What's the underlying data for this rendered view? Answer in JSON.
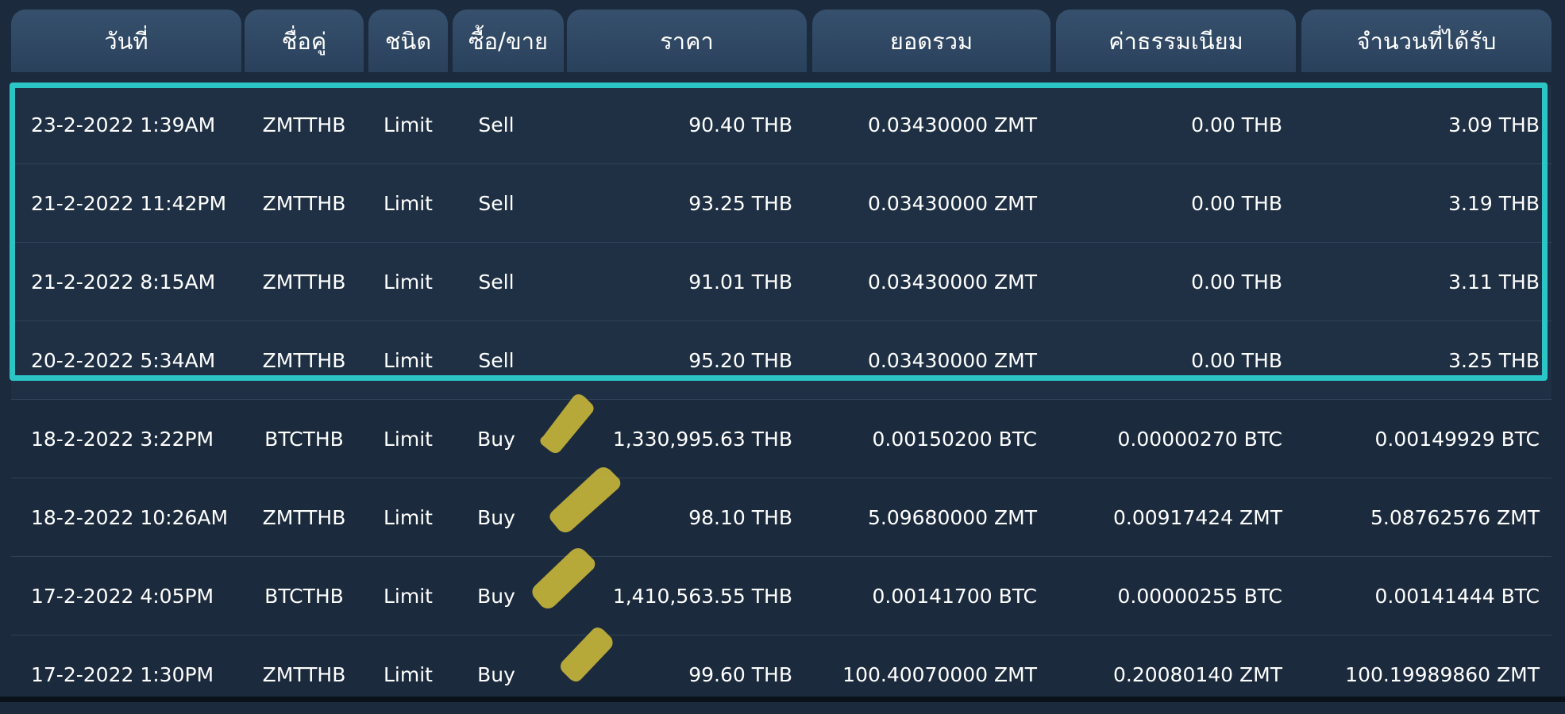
{
  "header": {
    "columns": [
      "วันที่",
      "ชื่อคู่",
      "ชนิด",
      "ซื้อ/ขาย",
      "ราคา",
      "ยอดรวม",
      "ค่าธรรมเนียม",
      "จำนวนที่ได้รับ"
    ]
  },
  "rows": [
    {
      "date": "23-2-2022 1:39AM",
      "pair": "ZMTTHB",
      "type": "Limit",
      "side": "Sell",
      "price": "90.40 THB",
      "total": "0.03430000 ZMT",
      "fee": "0.00 THB",
      "received": "3.09 THB"
    },
    {
      "date": "21-2-2022 11:42PM",
      "pair": "ZMTTHB",
      "type": "Limit",
      "side": "Sell",
      "price": "93.25 THB",
      "total": "0.03430000 ZMT",
      "fee": "0.00 THB",
      "received": "3.19 THB"
    },
    {
      "date": "21-2-2022 8:15AM",
      "pair": "ZMTTHB",
      "type": "Limit",
      "side": "Sell",
      "price": "91.01 THB",
      "total": "0.03430000 ZMT",
      "fee": "0.00 THB",
      "received": "3.11 THB"
    },
    {
      "date": "20-2-2022 5:34AM",
      "pair": "ZMTTHB",
      "type": "Limit",
      "side": "Sell",
      "price": "95.20 THB",
      "total": "0.03430000 ZMT",
      "fee": "0.00 THB",
      "received": "3.25 THB"
    },
    {
      "date": "18-2-2022 3:22PM",
      "pair": "BTCTHB",
      "type": "Limit",
      "side": "Buy",
      "price": "1,330,995.63 THB",
      "total": "0.00150200 BTC",
      "fee": "0.00000270 BTC",
      "received": "0.00149929 BTC"
    },
    {
      "date": "18-2-2022 10:26AM",
      "pair": "ZMTTHB",
      "type": "Limit",
      "side": "Buy",
      "price": "98.10 THB",
      "total": "5.09680000 ZMT",
      "fee": "0.00917424 ZMT",
      "received": "5.08762576 ZMT"
    },
    {
      "date": "17-2-2022 4:05PM",
      "pair": "BTCTHB",
      "type": "Limit",
      "side": "Buy",
      "price": "1,410,563.55 THB",
      "total": "0.00141700 BTC",
      "fee": "0.00000255 BTC",
      "received": "0.00141444 BTC"
    },
    {
      "date": "17-2-2022 1:30PM",
      "pair": "ZMTTHB",
      "type": "Limit",
      "side": "Buy",
      "price": "99.60 THB",
      "total": "100.40070000 ZMT",
      "fee": "0.20080140 ZMT",
      "received": "100.19989860 ZMT"
    }
  ],
  "colors": {
    "background": "#1b2a3c",
    "header": "#2f4863",
    "highlight_border": "#2bc5c6",
    "scribble": "#c9b63a"
  }
}
